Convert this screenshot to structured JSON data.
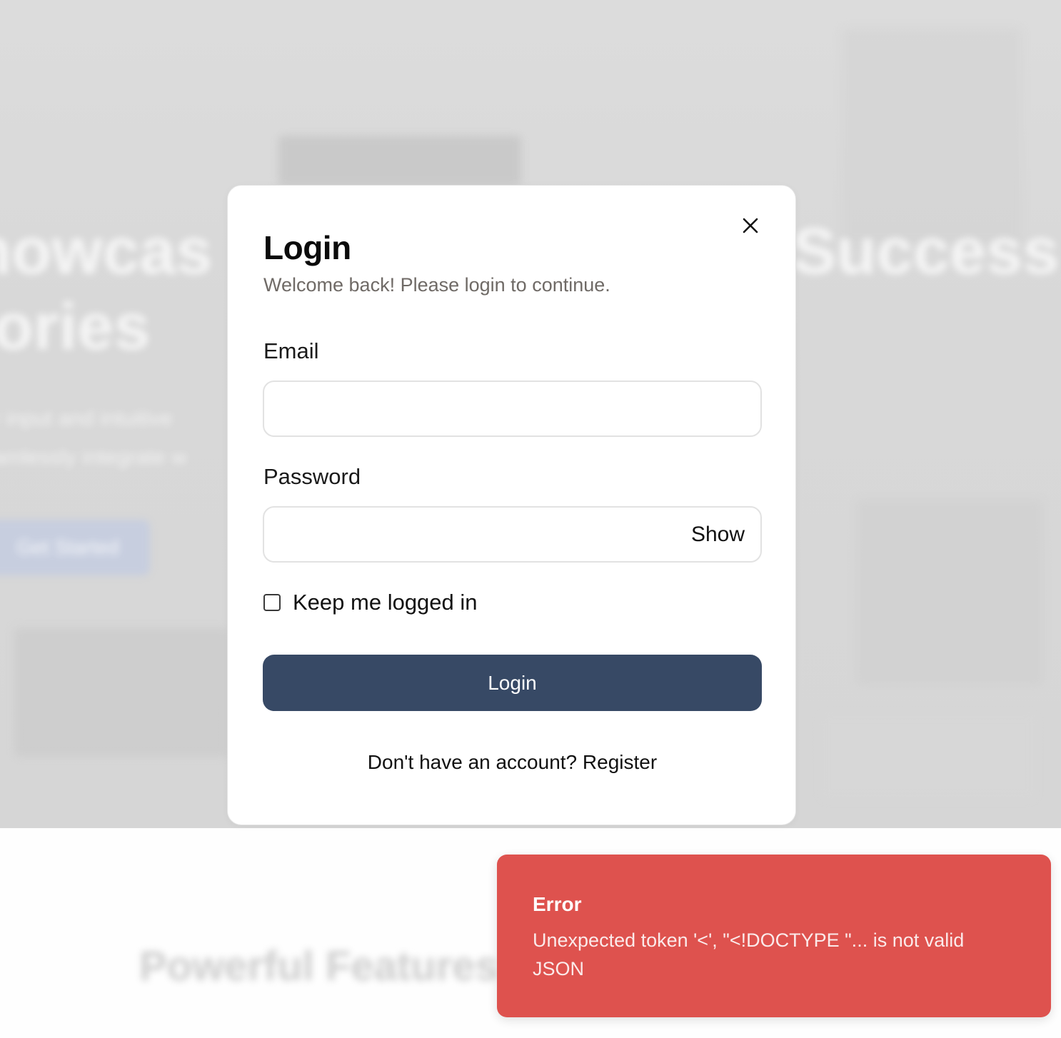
{
  "background": {
    "hero_title_left": "howcas",
    "hero_title_left_line2": "tories",
    "hero_title_right": "Success",
    "hero_subtitle_line1": "r input and intuitive",
    "hero_subtitle_line2": "amlessly integrate w",
    "hero_button": "Get Started",
    "section_title": "Powerful Features"
  },
  "modal": {
    "title": "Login",
    "subtitle": "Welcome back! Please login to continue.",
    "close_icon": "close-icon",
    "email": {
      "label": "Email",
      "value": "",
      "placeholder": ""
    },
    "password": {
      "label": "Password",
      "value": "",
      "placeholder": "",
      "toggle_label": "Show"
    },
    "keep_logged_in": {
      "label": "Keep me logged in",
      "checked": false
    },
    "login_button": "Login",
    "register_prompt": "Don't have an account?",
    "register_link": "Register"
  },
  "toast": {
    "title": "Error",
    "message": "Unexpected token '<', \"<!DOCTYPE \"... is not valid JSON",
    "color": "#de524e"
  },
  "colors": {
    "primary_button": "#374965",
    "error": "#de524e"
  }
}
